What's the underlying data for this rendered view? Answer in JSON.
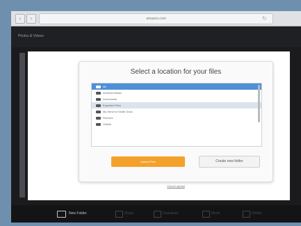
{
  "browser": {
    "url": "amazon.com",
    "back_icon": "chevron-left-icon",
    "forward_icon": "chevron-right-icon",
    "reload_icon": "reload-icon",
    "nav_back": "‹",
    "nav_forward": "›",
    "reload": "↻"
  },
  "app": {
    "title": "Photos & Videos"
  },
  "dialog": {
    "title": "Select a location for your files",
    "folders": [
      {
        "label": "All",
        "state": "selected"
      },
      {
        "label": "Archived Music",
        "state": ""
      },
      {
        "label": "Documents",
        "state": ""
      },
      {
        "label": "Expected Files",
        "state": "highlight"
      },
      {
        "label": "My Send to Kindle Docs",
        "state": ""
      },
      {
        "label": "Pictures",
        "state": ""
      },
      {
        "label": "Videos",
        "state": ""
      }
    ],
    "primary_button": "Upload Files",
    "secondary_button": "Create new folder",
    "cancel_link": "Cancel upload"
  },
  "bottom_bar": {
    "new_folder": "New Folder",
    "items": [
      "Share",
      "Download",
      "Move",
      "Delete"
    ]
  },
  "colors": {
    "accent": "#f4a12b",
    "selection": "#4f8fd6",
    "highlight": "#dbe3ed"
  }
}
